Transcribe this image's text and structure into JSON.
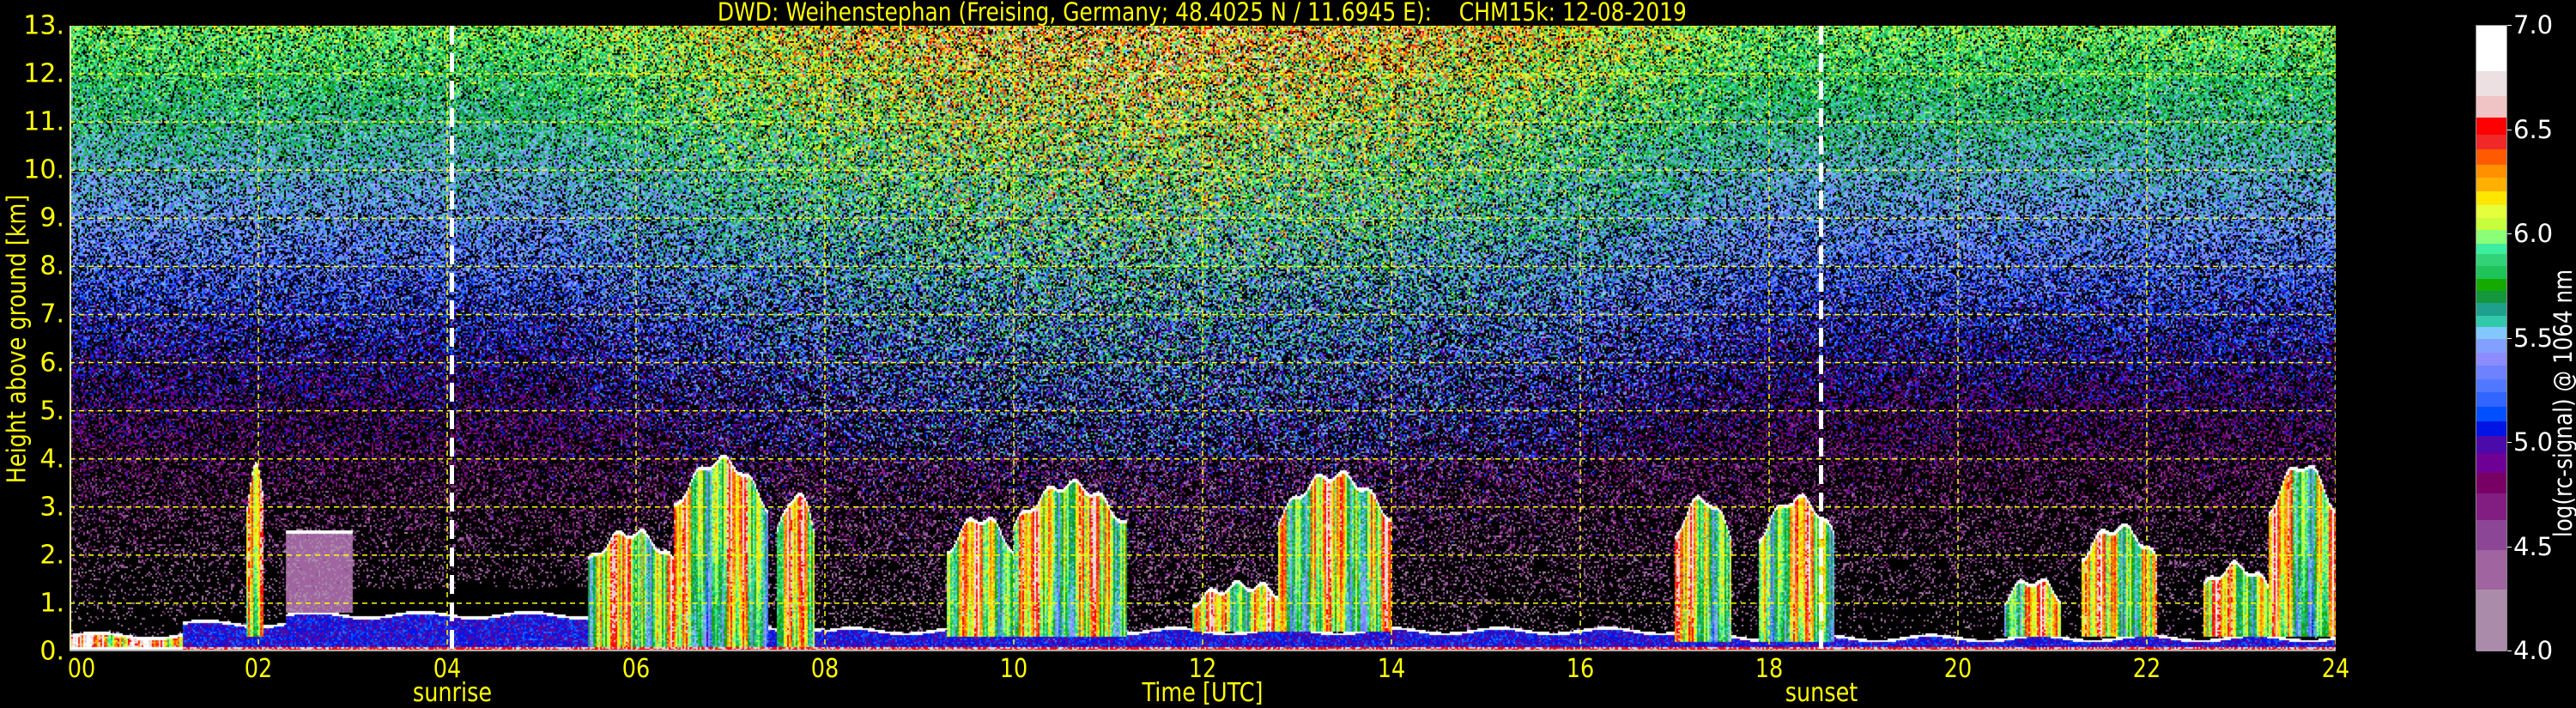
{
  "chart_data": {
    "type": "heatmap",
    "title": "DWD: Weihenstephan (Freising, Germany; 48.4025 N / 11.6945 E):    CHM15k: 12-08-2019",
    "xlabel": "Time [UTC]",
    "ylabel": "Height above ground [km]",
    "xlim": [
      0,
      24
    ],
    "ylim": [
      0,
      13
    ],
    "x_ticks": [
      0,
      2,
      4,
      6,
      8,
      10,
      12,
      14,
      16,
      18,
      20,
      22,
      24
    ],
    "x_tick_labels": [
      "00",
      "02",
      "04",
      "06",
      "08",
      "10",
      "12",
      "14",
      "16",
      "18",
      "20",
      "22",
      "24"
    ],
    "y_ticks": [
      0,
      1,
      2,
      3,
      4,
      5,
      6,
      7,
      8,
      9,
      10,
      11,
      12,
      13
    ],
    "y_tick_labels": [
      "0.",
      "1.",
      "2.",
      "3.",
      "4.",
      "5.",
      "6.",
      "7.",
      "8.",
      "9.",
      "10.",
      "11.",
      "12.",
      "13."
    ],
    "grid": true,
    "grid_color": "#ffff00",
    "text_color": "#ffff00",
    "events": [
      {
        "label": "sunrise",
        "time": 4.05
      },
      {
        "label": "sunset",
        "time": 18.55
      }
    ],
    "colorbar": {
      "label": "log(rc-signal) @ 1064 nm",
      "range": [
        4.0,
        7.0
      ],
      "tick_values": [
        4.0,
        4.5,
        5.0,
        5.5,
        6.0,
        6.5,
        7.0
      ],
      "tick_labels": [
        "4.0",
        "4.5",
        "5.0",
        "5.5",
        "6.0",
        "6.5",
        "7.0"
      ],
      "levels": [
        {
          "from": 4.0,
          "color": "#aa8caa"
        },
        {
          "from": 4.298,
          "color": "#a064a0"
        },
        {
          "from": 4.486,
          "color": "#8c4696"
        },
        {
          "from": 4.633,
          "color": "#821e82"
        },
        {
          "from": 4.759,
          "color": "#780064"
        },
        {
          "from": 4.86,
          "color": "#6e0096"
        },
        {
          "from": 4.951,
          "color": "#4b0aaa"
        },
        {
          "from": 5.033,
          "color": "#0014e6"
        },
        {
          "from": 5.104,
          "color": "#0050ff"
        },
        {
          "from": 5.174,
          "color": "#3264ff"
        },
        {
          "from": 5.243,
          "color": "#5078ff"
        },
        {
          "from": 5.308,
          "color": "#6e82ff"
        },
        {
          "from": 5.372,
          "color": "#8c8cff"
        },
        {
          "from": 5.433,
          "color": "#82a0ff"
        },
        {
          "from": 5.498,
          "color": "#82c8ff"
        },
        {
          "from": 5.556,
          "color": "#32c8aa"
        },
        {
          "from": 5.612,
          "color": "#1ea08c"
        },
        {
          "from": 5.671,
          "color": "#14963c"
        },
        {
          "from": 5.731,
          "color": "#14aa00"
        },
        {
          "from": 5.79,
          "color": "#1ec35a"
        },
        {
          "from": 5.848,
          "color": "#32d278"
        },
        {
          "from": 5.908,
          "color": "#3ceea0"
        },
        {
          "from": 5.958,
          "color": "#8cff78"
        },
        {
          "from": 6.023,
          "color": "#c8ff3c"
        },
        {
          "from": 6.081,
          "color": "#e6ff3c"
        },
        {
          "from": 6.14,
          "color": "#ffe600"
        },
        {
          "from": 6.207,
          "color": "#ffb000"
        },
        {
          "from": 6.272,
          "color": "#ff9000"
        },
        {
          "from": 6.336,
          "color": "#ff5a00"
        },
        {
          "from": 6.41,
          "color": "#f02828"
        },
        {
          "from": 6.481,
          "color": "#ff0000"
        },
        {
          "from": 6.563,
          "color": "#f0c4c4"
        },
        {
          "from": 6.665,
          "color": "#ece0e2"
        },
        {
          "from": 6.784,
          "color": "#ffffff"
        }
      ]
    },
    "boundary_layer": [
      {
        "start": 0.0,
        "end": 1.2,
        "top_km": 0.35
      },
      {
        "start": 1.2,
        "end": 2.3,
        "top_km": 0.6
      },
      {
        "start": 2.3,
        "end": 5.5,
        "top_km": 0.78
      },
      {
        "start": 5.5,
        "end": 8.0,
        "top_km": 0.5
      },
      {
        "start": 8.0,
        "end": 17.0,
        "top_km": 0.45
      },
      {
        "start": 17.0,
        "end": 24.0,
        "top_km": 0.3
      }
    ],
    "aerosol_layers": [
      {
        "start": 2.3,
        "end": 3.0,
        "base_km": 0.8,
        "top_km": 2.5
      }
    ],
    "clouds": [
      {
        "start": 1.88,
        "end": 2.06,
        "base_km": 0.3,
        "top_km": 4.0
      },
      {
        "start": 5.5,
        "end": 6.4,
        "base_km": 0.1,
        "top_km": 2.5
      },
      {
        "start": 6.4,
        "end": 7.4,
        "base_km": 0.1,
        "top_km": 4.0
      },
      {
        "start": 7.5,
        "end": 7.9,
        "base_km": 0.1,
        "top_km": 3.3
      },
      {
        "start": 9.3,
        "end": 10.0,
        "base_km": 0.3,
        "top_km": 2.8
      },
      {
        "start": 10.0,
        "end": 11.2,
        "base_km": 0.3,
        "top_km": 3.5
      },
      {
        "start": 11.9,
        "end": 13.0,
        "base_km": 0.4,
        "top_km": 1.4
      },
      {
        "start": 12.8,
        "end": 14.0,
        "base_km": 0.4,
        "top_km": 3.7
      },
      {
        "start": 17.0,
        "end": 17.6,
        "base_km": 0.2,
        "top_km": 3.2
      },
      {
        "start": 17.9,
        "end": 18.7,
        "base_km": 0.2,
        "top_km": 3.2
      },
      {
        "start": 20.5,
        "end": 21.1,
        "base_km": 0.3,
        "top_km": 1.5
      },
      {
        "start": 21.3,
        "end": 22.1,
        "base_km": 0.3,
        "top_km": 2.6
      },
      {
        "start": 22.6,
        "end": 23.3,
        "base_km": 0.3,
        "top_km": 1.8
      },
      {
        "start": 23.3,
        "end": 24.0,
        "base_km": 0.3,
        "top_km": 3.9
      }
    ]
  }
}
